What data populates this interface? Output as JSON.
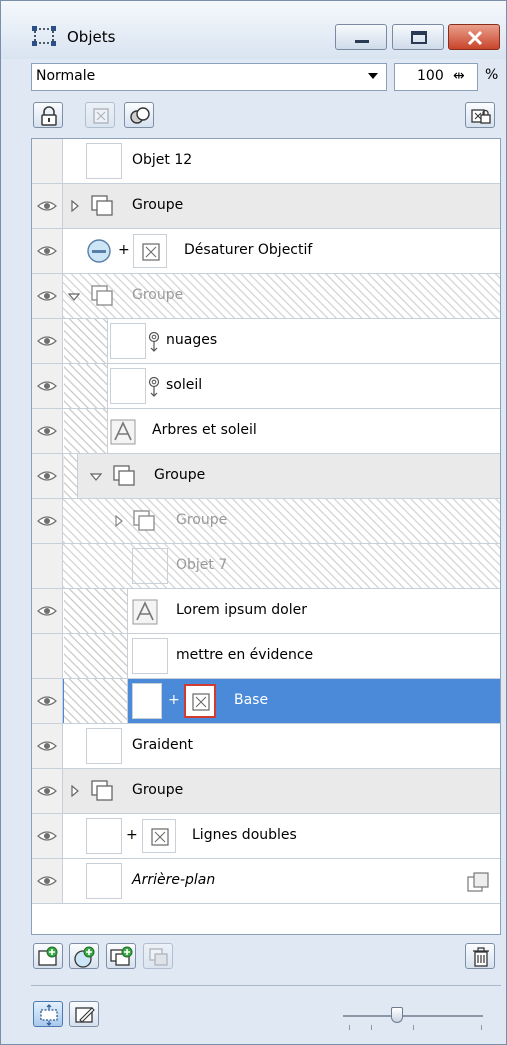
{
  "window": {
    "title": "Objets"
  },
  "blend": {
    "mode": "Normale",
    "opacity": "100",
    "opacity_spin": "⇹",
    "opacity_unit": "%"
  },
  "layers": [
    {
      "label": "Objet 12"
    },
    {
      "label": "Groupe"
    },
    {
      "label": "Désaturer Objectif"
    },
    {
      "label": "Groupe"
    },
    {
      "label": "nuages"
    },
    {
      "label": "soleil"
    },
    {
      "label": "Arbres et soleil"
    },
    {
      "label": "Groupe"
    },
    {
      "label": "Groupe"
    },
    {
      "label": "Objet 7"
    },
    {
      "label": "Lorem ipsum doler"
    },
    {
      "label": "mettre en évidence"
    },
    {
      "label": "Base"
    },
    {
      "label": "Graident"
    },
    {
      "label": "Groupe"
    },
    {
      "label": "Lignes doubles"
    },
    {
      "label": "Arrière-plan"
    }
  ],
  "colors": {
    "selected_row": "#4a8ad8",
    "panel_background": "#dfe8f3",
    "close_button": "#c9452b"
  },
  "icons": {
    "title": "objects-panel-icon",
    "lock": "lock-icon",
    "mask": "mask-icon",
    "combine": "combine-icon",
    "options": "options-icon",
    "new_object": "new-object-icon",
    "new_effect": "new-effect-icon",
    "new_group": "new-group-icon",
    "merge": "merge-icon",
    "delete": "trash-icon"
  }
}
